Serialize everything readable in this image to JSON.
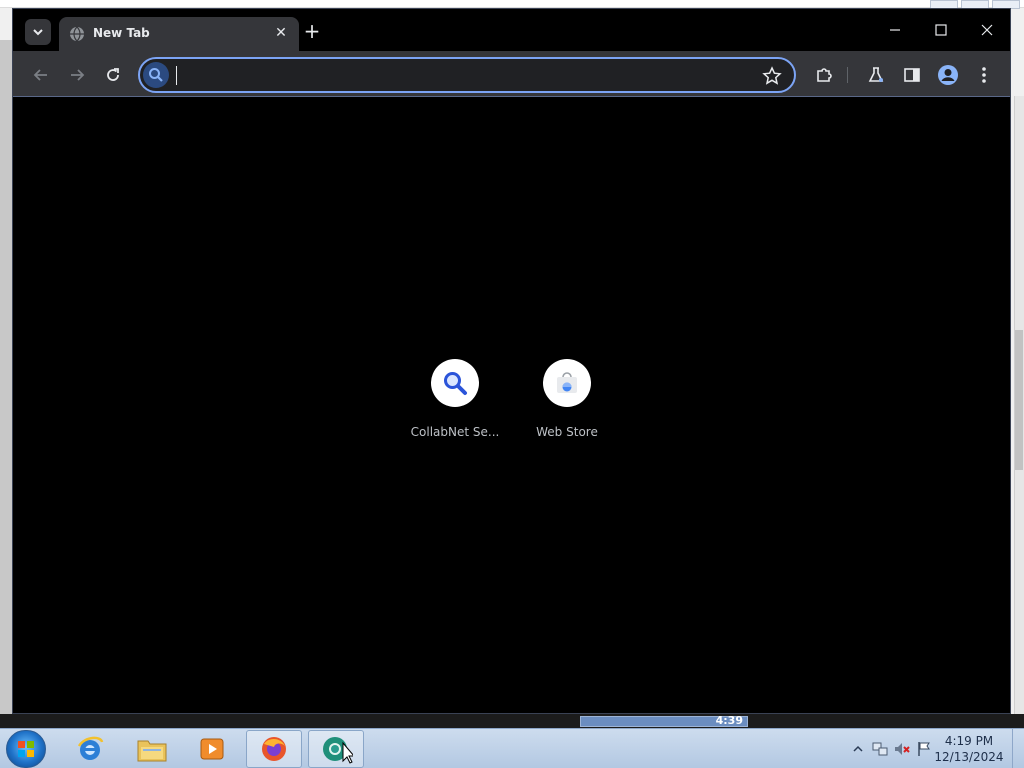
{
  "browser": {
    "tab_title": "New Tab",
    "omnibox_value": "",
    "colors": {
      "frame": "#000000",
      "toolbar": "#35363a",
      "omnibox_border": "#7ca4f5",
      "page_background": "#000000"
    }
  },
  "shortcuts": [
    {
      "label": "CollabNet Se...",
      "icon": "search-icon"
    },
    {
      "label": "Web Store",
      "icon": "web-store-icon"
    }
  ],
  "media_player": {
    "time": "4:39"
  },
  "taskbar": {
    "apps": [
      "internet-explorer-icon",
      "file-explorer-icon",
      "media-player-icon",
      "firefox-icon",
      "chrome-icon"
    ],
    "clock_time": "4:19 PM",
    "clock_date": "12/13/2024"
  }
}
